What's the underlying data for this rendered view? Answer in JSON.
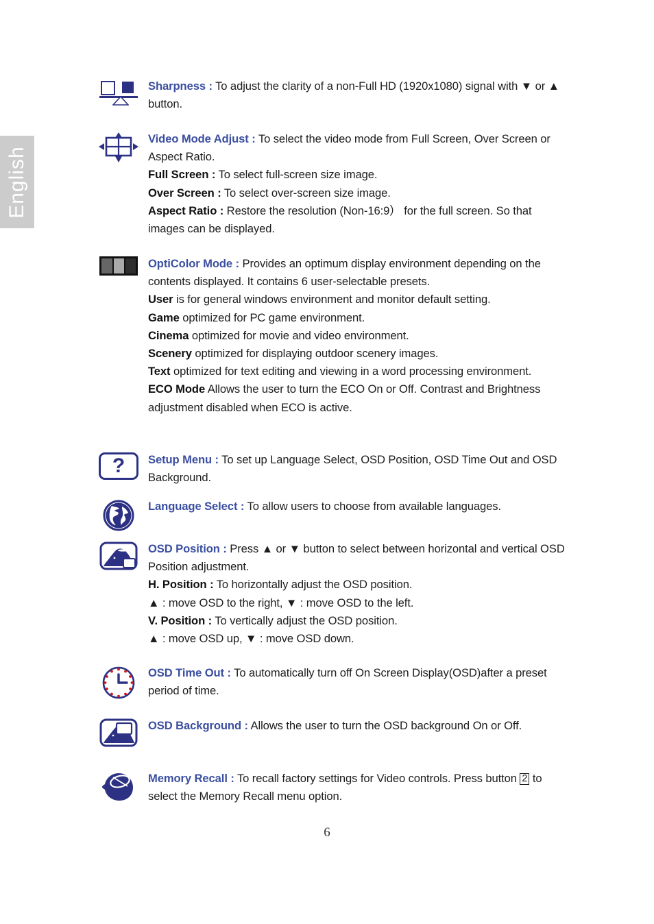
{
  "sidebar": {
    "language_tab": "English"
  },
  "page": {
    "number": "6"
  },
  "sections": [
    {
      "icon": "sharpness-icon",
      "heading": "Sharpness :",
      "body": " To adjust the clarity of a non-Full HD (1920x1080) signal with ▼ or ▲ button."
    },
    {
      "icon": "video-mode-adjust-icon",
      "heading": "Video Mode Adjust :",
      "body": " To select the video mode from Full Screen, Over Screen or Aspect Ratio.",
      "items": [
        {
          "term": "Full Screen :",
          "desc": " To select full-screen size image."
        },
        {
          "term": "Over Screen :",
          "desc": " To select over-screen size image."
        },
        {
          "term": "Aspect Ratio :",
          "desc": " Restore the resolution (Non-16:9） for the full screen. So that images can be displayed."
        }
      ]
    },
    {
      "icon": "opticolor-mode-icon",
      "heading": "OptiColor Mode :",
      "body": " Provides an optimum display environment depending on the contents displayed. It contains 6 user-selectable presets.",
      "items": [
        {
          "term": "User",
          "desc": " is for general windows environment and monitor default setting."
        },
        {
          "term": "Game",
          "desc": " optimized for PC game environment."
        },
        {
          "term": "Cinema",
          "desc": " optimized for movie and video environment."
        },
        {
          "term": "Scenery",
          "desc": " optimized for displaying outdoor scenery images."
        },
        {
          "term": "Text",
          "desc": " optimized for text editing and viewing in a word processing environment."
        },
        {
          "term": "ECO Mode",
          "desc": " Allows the user to turn the ECO On or Off. Contrast and Brightness adjustment disabled when ECO is active."
        }
      ]
    },
    {
      "icon": "setup-menu-icon",
      "icon_glyph": "?",
      "heading": "Setup Menu :",
      "body": " To set up Language Select, OSD Position, OSD Time Out and OSD Background."
    },
    {
      "icon": "language-select-globe-icon",
      "heading": "Language Select :",
      "body": " To allow users to choose from available languages."
    },
    {
      "icon": "osd-position-icon",
      "heading": "OSD Position :",
      "body": " Press ▲ or ▼ button to select between horizontal and vertical OSD Position adjustment.",
      "items": [
        {
          "term": "H. Position :",
          "desc": " To horizontally adjust the OSD position."
        },
        {
          "term": "▲ :",
          "desc": " move OSD to the right, ▼ : move OSD to the left.",
          "term_plain": true
        },
        {
          "term": "V. Position :",
          "desc": " To vertically adjust the OSD position."
        },
        {
          "term": "▲ :",
          "desc": " move OSD up, ▼ : move OSD down.",
          "term_plain": true
        }
      ]
    },
    {
      "icon": "osd-time-out-clock-icon",
      "heading": "OSD Time Out :",
      "body": " To automatically turn off On Screen Display(OSD)after a preset period of time."
    },
    {
      "icon": "osd-background-icon",
      "heading": "OSD Background :",
      "body": " Allows the user to turn the OSD background On or Off."
    },
    {
      "icon": "memory-recall-icon",
      "heading": "Memory Recall :",
      "body_pre": " To recall factory settings for Video controls. Press button ",
      "boxed": "2",
      "body_post": " to select the Memory Recall menu option."
    }
  ]
}
